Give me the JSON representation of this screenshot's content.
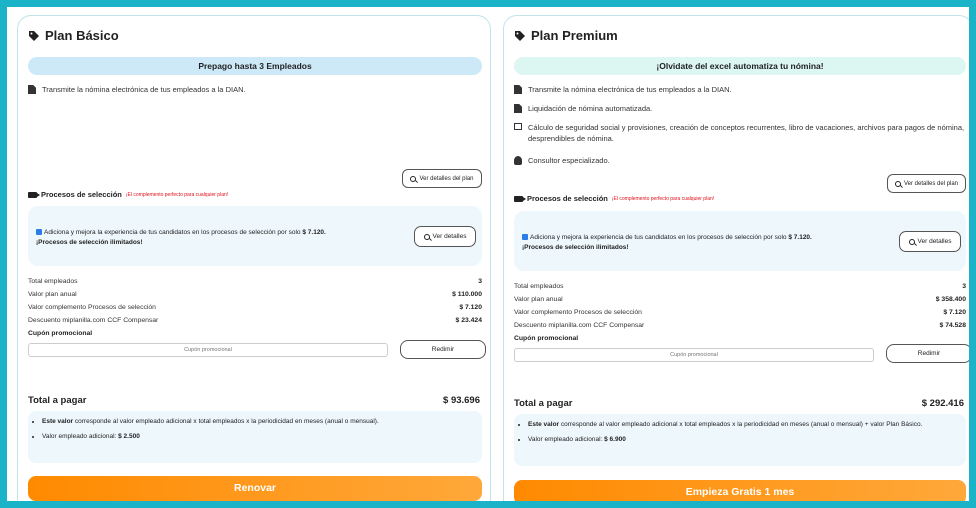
{
  "basic": {
    "title": "Plan Básico",
    "banner": "Prepago hasta 3 Empleados",
    "features": [
      "Transmite la nómina electrónica de tus empleados a la DIAN."
    ],
    "details_button": "Ver detalles del plan",
    "proc_title": "Procesos de selección",
    "proc_tagline": "¡El complemento perfecto para cualquier plan!",
    "proc_text": "Adiciona y mejora la experiencia de tus candidatos en los procesos de selección por solo",
    "proc_price": "$ 7.120.",
    "proc_unlimited": "¡Procesos de selección ilimitados!",
    "proc_button": "Ver detalles",
    "summary": [
      {
        "label": "Total empleados",
        "value": "3"
      },
      {
        "label": "Valor plan anual",
        "value": "$ 110.000"
      },
      {
        "label": "Valor complemento Procesos de selección",
        "value": "$ 7.120"
      },
      {
        "label": "Descuento miplanilla.com CCF Compensar",
        "value": "$ 23.424"
      }
    ],
    "cupon_label": "Cupón promocional",
    "cupon_placeholder": "Cupón promocional",
    "redeem_button": "Redimir",
    "total_label": "Total a pagar",
    "total_value": "$ 93.696",
    "note1_bold": "Este valor",
    "note1_rest": "corresponde al valor empleado adicional x total empleados x la periodicidad en meses (anual o mensual).",
    "note2_label": "Valor empleado adicional:",
    "note2_value": "$ 2.500",
    "cta": "Renovar"
  },
  "premium": {
    "title": "Plan Premium",
    "banner": "¡Olvidate del excel automatiza tu nómina!",
    "features": [
      "Transmite la nómina electrónica de tus empleados a la DIAN.",
      "Liquidación de nómina automatizada.",
      "Cálculo de seguridad social y provisiones, creación de conceptos recurrentes, libro de vacaciones, archivos para pagos de nómina, desprendibles de nómina.",
      "Consultor especializado."
    ],
    "details_button": "Ver detalles del plan",
    "proc_title": "Procesos de selección",
    "proc_tagline": "¡El complemento perfecto para cualquier plan!",
    "proc_text": "Adiciona y mejora la experiencia de tus candidatos en los procesos de selección por solo",
    "proc_price": "$ 7.120.",
    "proc_unlimited": "¡Procesos de selección ilimitados!",
    "proc_button": "Ver detalles",
    "summary": [
      {
        "label": "Total empleados",
        "value": "3"
      },
      {
        "label": "Valor plan anual",
        "value": "$ 358.400"
      },
      {
        "label": "Valor complemento Procesos de selección",
        "value": "$ 7.120"
      },
      {
        "label": "Descuento miplanilla.com CCF Compensar",
        "value": "$ 74.528"
      }
    ],
    "cupon_label": "Cupón promocional",
    "cupon_placeholder": "Cupón promocional",
    "redeem_button": "Redimir",
    "total_label": "Total a pagar",
    "total_value": "$ 292.416",
    "note1_bold": "Este valor",
    "note1_rest": "corresponde al valor empleado adicional x total empleados x la periodicidad en meses (anual o mensual) + valor Plan Básico.",
    "note2_label": "Valor empleado adicional:",
    "note2_value": "$ 6.900",
    "cta": "Empieza Gratis 1 mes"
  },
  "colors": {
    "frame": "#1bb3c7",
    "cta_start": "#ff8a00",
    "cta_end": "#ffa83a",
    "tagline": "#e0101a",
    "banner_basic": "#cde9f8",
    "banner_premium": "#dcf7f2"
  }
}
